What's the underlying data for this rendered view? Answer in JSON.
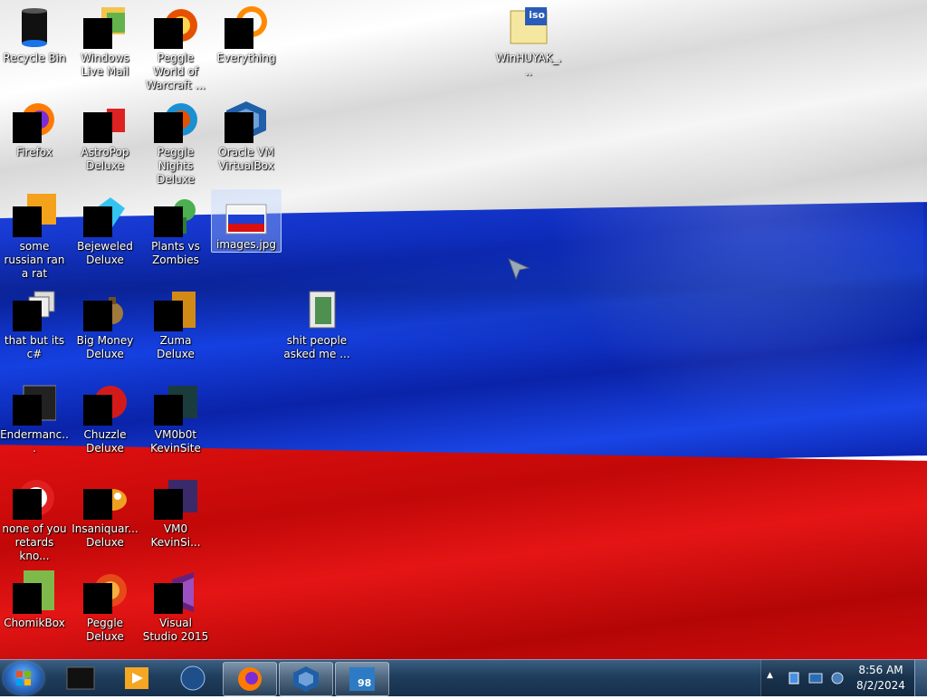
{
  "desktop": {
    "icons": [
      {
        "label": "Recycle Bin"
      },
      {
        "label": "Windows Live Mail"
      },
      {
        "label": "Peggle World of Warcraft ..."
      },
      {
        "label": "Everything"
      },
      {
        "label": "WinHUYAK_..."
      },
      {
        "label": "Firefox"
      },
      {
        "label": "AstroPop Deluxe"
      },
      {
        "label": "Peggle Nights Deluxe"
      },
      {
        "label": "Oracle VM VirtualBox"
      },
      {
        "label": "some russian ran a rat"
      },
      {
        "label": "Bejeweled Deluxe"
      },
      {
        "label": "Plants vs Zombies"
      },
      {
        "label": "images.jpg"
      },
      {
        "label": "that but its c#"
      },
      {
        "label": "Big Money Deluxe"
      },
      {
        "label": "Zuma Deluxe"
      },
      {
        "label": "shit people asked me ..."
      },
      {
        "label": "Endermanc..."
      },
      {
        "label": "Chuzzle Deluxe"
      },
      {
        "label": "VM0b0t KevinSite"
      },
      {
        "label": "none of you retards kno..."
      },
      {
        "label": "Insaniquar... Deluxe"
      },
      {
        "label": "VM0 KevinSi..."
      },
      {
        "label": "ChomikBox"
      },
      {
        "label": "Peggle Deluxe"
      },
      {
        "label": "Visual Studio 2015"
      }
    ]
  },
  "iso_badge": "iso",
  "taskbar": {
    "items": [
      {
        "name": "cmd-window"
      },
      {
        "name": "media-player"
      },
      {
        "name": "globe"
      },
      {
        "name": "firefox"
      },
      {
        "name": "virtualbox"
      },
      {
        "name": "windows-98-vm",
        "badge": "98"
      }
    ]
  },
  "tray": {
    "time": "8:56 AM",
    "date": "8/2/2024",
    "expand": "▲"
  },
  "colors": {
    "flag_white": "#ffffff",
    "flag_blue": "#0c2ab8",
    "flag_red": "#d60d0d"
  }
}
